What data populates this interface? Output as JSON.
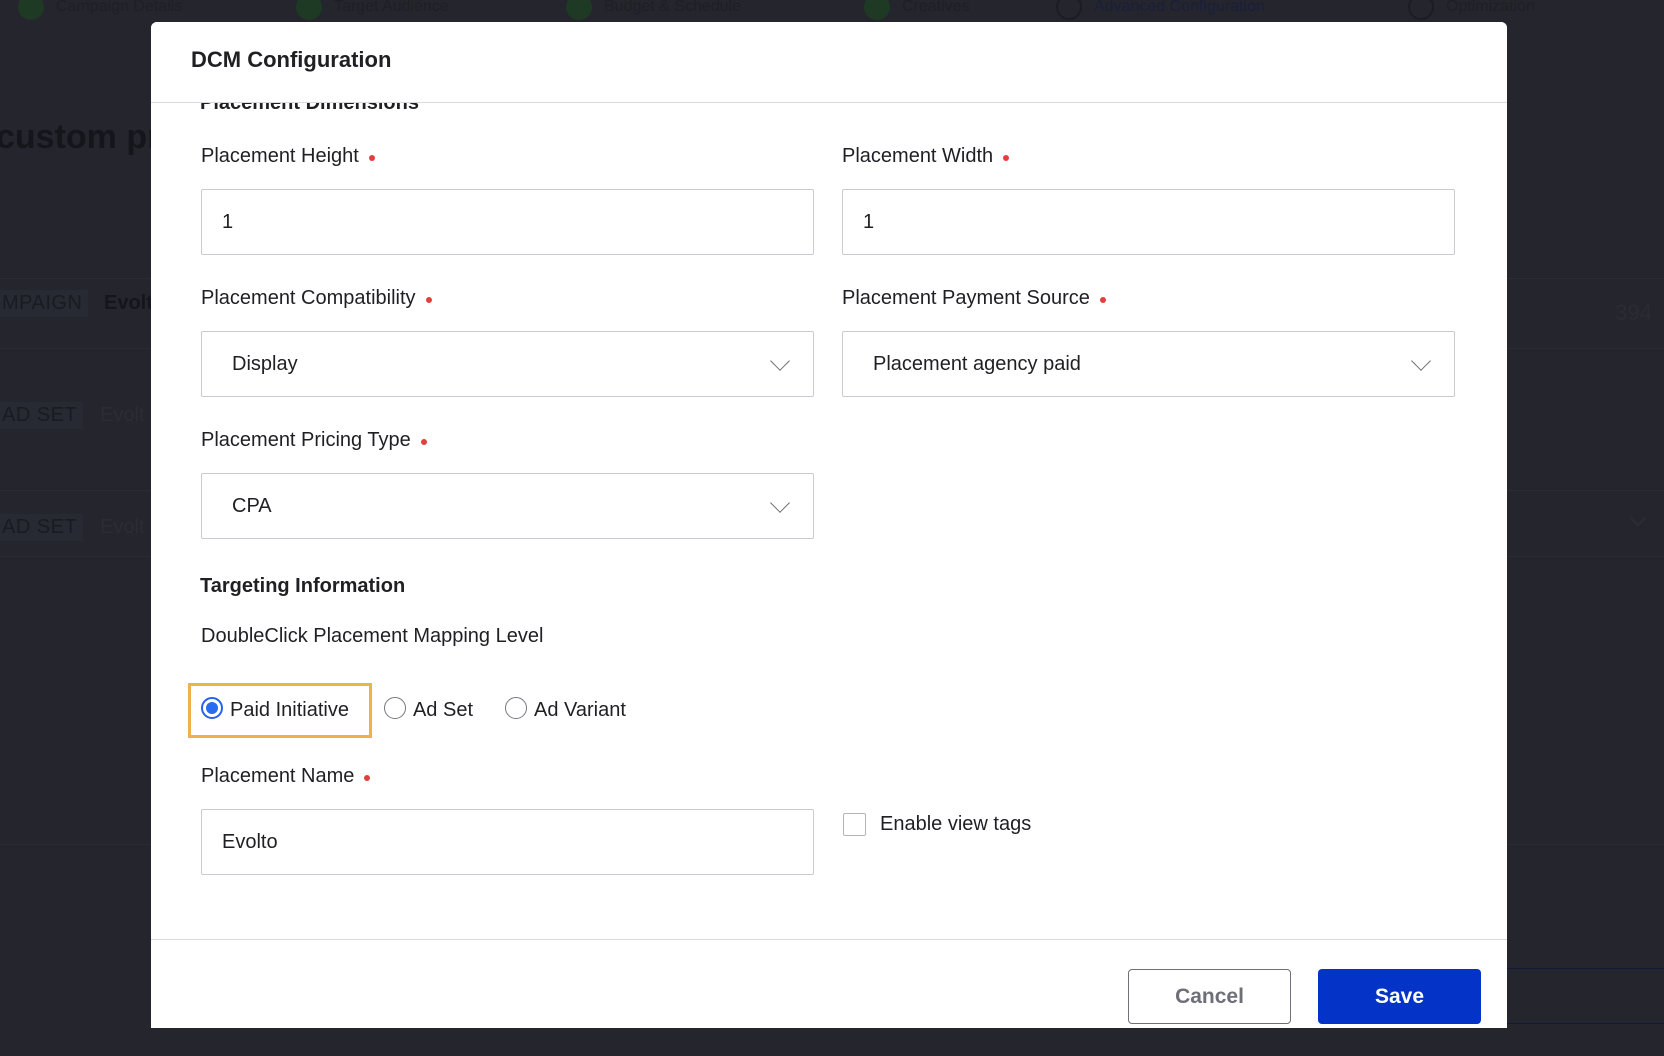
{
  "background": {
    "steps": [
      {
        "label": "Campaign Details",
        "state": "complete"
      },
      {
        "label": "Target Audience",
        "state": "complete"
      },
      {
        "label": "Budget & Schedule",
        "state": "complete"
      },
      {
        "label": "Creatives",
        "state": "complete"
      },
      {
        "label": "Advanced Configuration",
        "state": "current"
      },
      {
        "label": "Optimization",
        "state": "pending"
      }
    ],
    "heading": "custom pr",
    "rows": [
      {
        "tag": "MPAIGN",
        "name": "Evolt"
      },
      {
        "tag": "AD SET",
        "name": "Evolt"
      },
      {
        "tag": "AD SET",
        "name": "Evolt"
      }
    ],
    "count": "394"
  },
  "modal": {
    "title": "DCM Configuration",
    "cut_section": "Placement Dimensions",
    "fields": {
      "height": {
        "label": "Placement Height",
        "value": "1",
        "required": true
      },
      "width": {
        "label": "Placement Width",
        "value": "1",
        "required": true
      },
      "compatibility": {
        "label": "Placement Compatibility",
        "value": "Display",
        "required": true
      },
      "payment_source": {
        "label": "Placement Payment Source",
        "value": "Placement agency paid",
        "required": true
      },
      "pricing_type": {
        "label": "Placement Pricing Type",
        "value": "CPA",
        "required": true
      },
      "placement_name": {
        "label": "Placement Name",
        "value": "Evolto",
        "required": true
      }
    },
    "targeting": {
      "title": "Targeting Information",
      "mapping_label": "DoubleClick Placement Mapping Level",
      "options": [
        {
          "label": "Paid Initiative",
          "checked": true
        },
        {
          "label": "Ad Set",
          "checked": false
        },
        {
          "label": "Ad Variant",
          "checked": false
        }
      ]
    },
    "enable_view_tags": {
      "label": "Enable view tags",
      "checked": false
    },
    "footer": {
      "cancel_label": "Cancel",
      "save_label": "Save"
    }
  },
  "colors": {
    "primary": "#0433c7",
    "required": "#e0413c",
    "focus_ring": "#f0b04a",
    "radio_checked": "#2a6cf0"
  }
}
